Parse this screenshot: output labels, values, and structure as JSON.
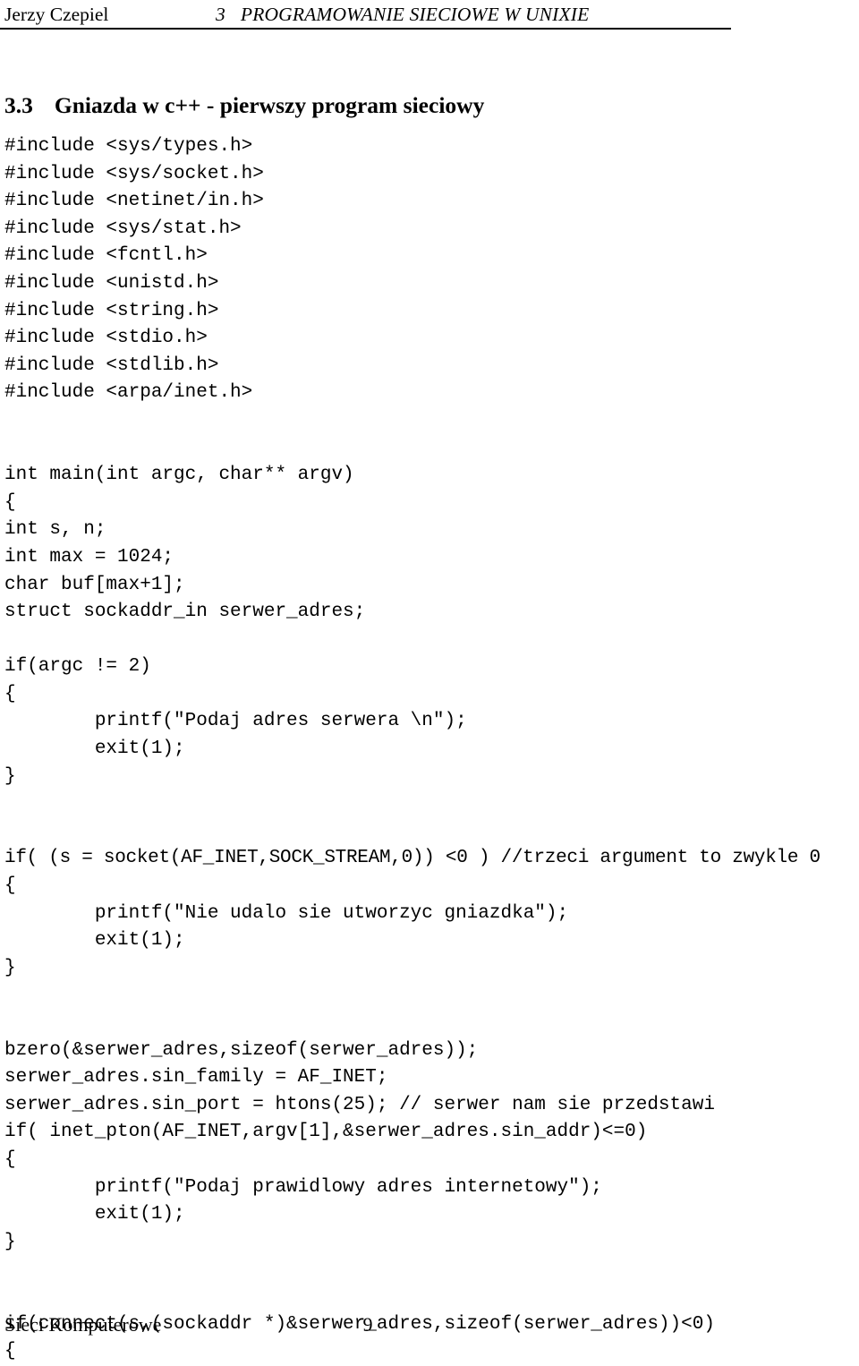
{
  "header": {
    "author": "Jerzy Czepiel",
    "section_number": "3",
    "section_title": "PROGRAMOWANIE SIECIOWE W UNIXIE"
  },
  "section": {
    "number": "3.3",
    "title": "Gniazda w c++ - pierwszy program sieciowy"
  },
  "code": {
    "lines": [
      "#include <sys/types.h>",
      "#include <sys/socket.h>",
      "#include <netinet/in.h>",
      "#include <sys/stat.h>",
      "#include <fcntl.h>",
      "#include <unistd.h>",
      "#include <string.h>",
      "#include <stdio.h>",
      "#include <stdlib.h>",
      "#include <arpa/inet.h>",
      "",
      "",
      "int main(int argc, char** argv)",
      "{",
      "int s, n;",
      "int max = 1024;",
      "char buf[max+1];",
      "struct sockaddr_in serwer_adres;",
      "",
      "if(argc != 2)",
      "{",
      "        printf(\"Podaj adres serwera \\n\");",
      "        exit(1);",
      "}",
      "",
      "",
      "if( (s = socket(AF_INET,SOCK_STREAM,0)) <0 ) //trzeci argument to zwykle 0",
      "{",
      "        printf(\"Nie udalo sie utworzyc gniazdka\");",
      "        exit(1);",
      "}",
      "",
      "",
      "bzero(&serwer_adres,sizeof(serwer_adres));",
      "serwer_adres.sin_family = AF_INET;",
      "serwer_adres.sin_port = htons(25); // serwer nam sie przedstawi",
      "if( inet_pton(AF_INET,argv[1],&serwer_adres.sin_addr)<=0)",
      "{",
      "        printf(\"Podaj prawidlowy adres internetowy\");",
      "        exit(1);",
      "}",
      "",
      "",
      "if(connect(s,(sockaddr *)&serwer_adres,sizeof(serwer_adres))<0)",
      "{"
    ],
    "tight_line_index": 26
  },
  "footer": {
    "document_title": "Sieci Komputerowe",
    "page_number": "9"
  }
}
